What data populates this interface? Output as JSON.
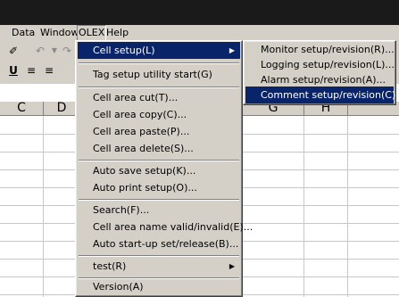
{
  "menubar": {
    "items": [
      {
        "label": "Data"
      },
      {
        "label": "Window"
      },
      {
        "label": "OLEX"
      },
      {
        "label": "Help"
      }
    ]
  },
  "toolbar": {
    "bold_label": "U",
    "icons": [
      "pen-icon",
      "undo-icon",
      "redo-icon",
      "underline-icon",
      "align-left-icon",
      "align-center-icon"
    ]
  },
  "columns": [
    "C",
    "D",
    "G",
    "H"
  ],
  "olex_menu": {
    "items": [
      {
        "label": "Cell setup(L)",
        "has_submenu": true
      },
      {
        "label": "Tag setup utility start(G)"
      },
      {
        "label": "Cell area cut(T)..."
      },
      {
        "label": "Cell area copy(C)..."
      },
      {
        "label": "Cell area paste(P)..."
      },
      {
        "label": "Cell area delete(S)..."
      },
      {
        "label": "Auto save setup(K)..."
      },
      {
        "label": "Auto print setup(O)..."
      },
      {
        "label": "Search(F)..."
      },
      {
        "label": "Cell area name valid/invalid(E)..."
      },
      {
        "label": "Auto start-up set/release(B)..."
      },
      {
        "label": "test(R)",
        "has_submenu": true
      },
      {
        "label": "Version(A)"
      }
    ]
  },
  "cell_setup_submenu": {
    "items": [
      {
        "label": "Monitor setup/revision(R)..."
      },
      {
        "label": "Logging setup/revision(L)..."
      },
      {
        "label": "Alarm setup/revision(A)..."
      },
      {
        "label": "Comment setup/revision(C)..."
      }
    ]
  },
  "colors": {
    "menu_bg": "#d4d0c8",
    "highlight": "#0a246a",
    "titlebar": "#1a1a1a"
  }
}
